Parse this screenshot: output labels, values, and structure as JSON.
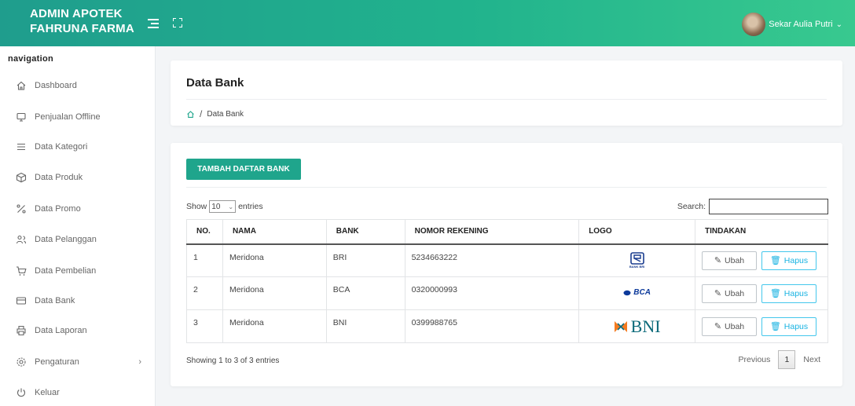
{
  "app": {
    "brand": "ADMIN APOTEK FAHRUNA FARMA",
    "user_name": "Sekar Aulia Putri",
    "user_caret": "⌄"
  },
  "sidebar": {
    "title": "navigation",
    "items": [
      {
        "label": "Dashboard",
        "icon": "home-icon"
      },
      {
        "label": "Penjualan Offline",
        "icon": "monitor-icon"
      },
      {
        "label": "Data Kategori",
        "icon": "list-icon"
      },
      {
        "label": "Data Produk",
        "icon": "box-icon"
      },
      {
        "label": "Data Promo",
        "icon": "percent-icon"
      },
      {
        "label": "Data Pelanggan",
        "icon": "users-icon"
      },
      {
        "label": "Data Pembelian",
        "icon": "cart-icon"
      },
      {
        "label": "Data Bank",
        "icon": "credit-card-icon"
      },
      {
        "label": "Data Laporan",
        "icon": "printer-icon"
      },
      {
        "label": "Pengaturan",
        "icon": "settings-icon",
        "chevron": "›"
      },
      {
        "label": "Keluar",
        "icon": "power-icon"
      }
    ]
  },
  "page": {
    "title": "Data Bank",
    "breadcrumb_sep": "/",
    "breadcrumb_current": "Data Bank"
  },
  "toolbar": {
    "add_button": "TAMBAH DAFTAR BANK"
  },
  "table_controls": {
    "show_label": "Show",
    "entries_value": "10",
    "entries_label": "entries",
    "search_label": "Search:"
  },
  "table": {
    "headers": [
      "NO.",
      "NAMA",
      "BANK",
      "NOMOR REKENING",
      "LOGO",
      "TINDAKAN"
    ],
    "rows": [
      {
        "no": "1",
        "nama": "Meridona",
        "bank": "BRI",
        "rekening": "5234663222",
        "logo": "BRI",
        "logo_caption": "BANK BRI"
      },
      {
        "no": "2",
        "nama": "Meridona",
        "bank": "BCA",
        "rekening": "0320000993",
        "logo": "BCA"
      },
      {
        "no": "3",
        "nama": "Meridona",
        "bank": "BNI",
        "rekening": "0399988765",
        "logo": "BNI"
      }
    ],
    "edit_label": "Ubah",
    "delete_label": "Hapus"
  },
  "footer": {
    "info": "Showing 1 to 3 of 3 entries",
    "prev": "Previous",
    "page": "1",
    "next": "Next"
  },
  "colors": {
    "accent": "#1fa58c",
    "header_start": "#1f9d8d",
    "header_end": "#38c98f",
    "info_blue": "#19b3e2"
  }
}
